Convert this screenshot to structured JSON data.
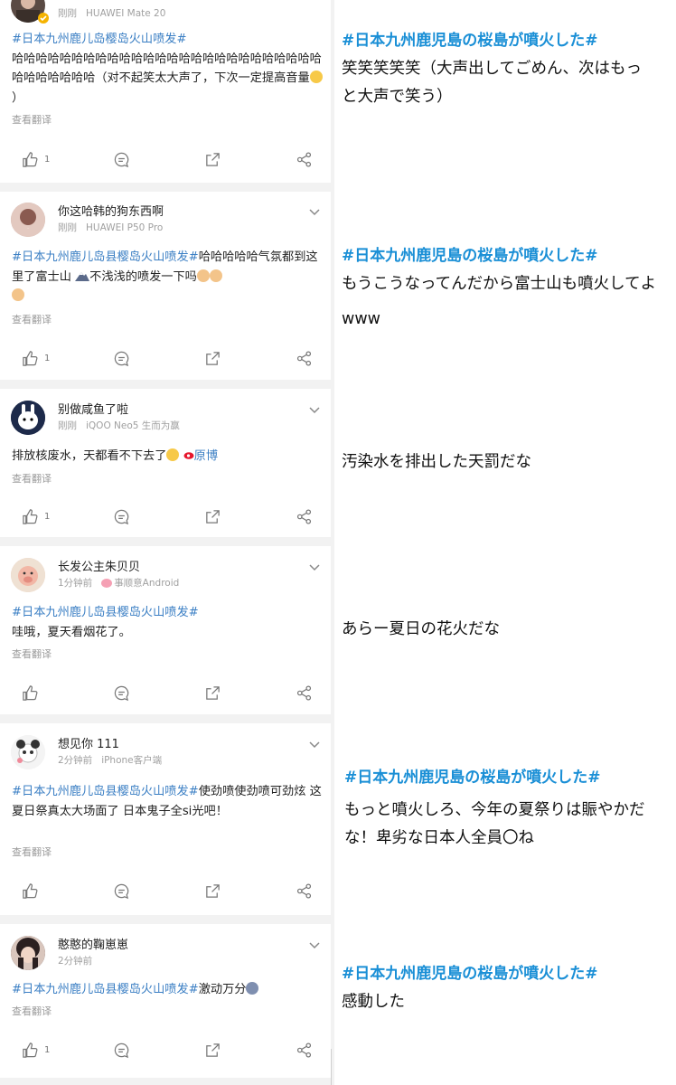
{
  "posts": [
    {
      "username": "",
      "time": "刚刚",
      "device": "HUAWEI Mate 20",
      "tag": "#日本九州鹿儿岛樱岛火山喷发#",
      "text": "哈哈哈哈哈哈哈哈哈哈哈哈哈哈哈哈哈哈哈哈哈哈哈哈哈哈哈哈哈哈哈哈哈（对不起笑太大声了，下次一定提高音量",
      "translate": "查看翻译",
      "likes": "1"
    },
    {
      "username": "你这哈韩的狗东西啊",
      "time": "刚刚",
      "device": "HUAWEI P50 Pro",
      "tag": "#日本九州鹿儿岛县樱岛火山喷发#",
      "text": "哈哈哈哈哈气氛都到这里了富士山",
      "text2": "不浅浅的喷发一下吗",
      "translate": "查看翻译",
      "likes": "1"
    },
    {
      "username": "别做咸鱼了啦",
      "time": "刚刚",
      "device": "iQOO Neo5 生而为赢",
      "text": "排放核废水，天都看不下去了",
      "link": "原博",
      "translate": "查看翻译",
      "likes": "1"
    },
    {
      "username": "长发公主朱贝贝",
      "time": "1分钟前",
      "device": "事顺意Android",
      "tag": "#日本九州鹿儿岛县樱岛火山喷发#",
      "text": "哇哦，夏天看烟花了。",
      "translate": "查看翻译",
      "likes": ""
    },
    {
      "username": "想见你 111",
      "time": "2分钟前",
      "device": "iPhone客户端",
      "tag": "#日本九州鹿儿岛县樱岛火山喷发#",
      "text": "使劲喷使劲喷可劲炫 这夏日祭真太大场面了 日本鬼子全si光吧！",
      "translate": "查看翻译",
      "likes": ""
    },
    {
      "username": "憨憨的鞠崽崽",
      "time": "2分钟前",
      "device": "",
      "tag": "#日本九州鹿儿岛县樱岛火山喷发#",
      "text": "激动万分",
      "translate": "查看翻译",
      "likes": "1"
    }
  ],
  "translations": [
    {
      "tag": "#日本九州鹿児島の桜島が噴火した#",
      "lines": [
        "笑笑笑笑笑（大声出してごめん、次はもっ",
        "と大声で笑う）"
      ]
    },
    {
      "tag": "#日本九州鹿児島の桜島が噴火した#",
      "lines": [
        "もうこうなってんだから富士山も噴火してよ",
        "www"
      ]
    },
    {
      "tag": "",
      "lines": [
        "汚染水を排出した天罰だな"
      ]
    },
    {
      "tag": "",
      "lines": [
        "あらー夏日の花火だな"
      ]
    },
    {
      "tag": "#日本九州鹿児島の桜島が噴火した#",
      "lines": [
        "もっと噴火しろ、今年の夏祭りは賑やかだ",
        "な！卑劣な日本人全員〇ね"
      ]
    },
    {
      "tag": "#日本九州鹿児島の桜島が噴火した#",
      "lines": [
        "感動した"
      ]
    }
  ],
  "colors": {
    "tag_blue": "#3b7fc4",
    "jp_tag_blue": "#1a8fd6",
    "separator": "#f2f2f2"
  }
}
